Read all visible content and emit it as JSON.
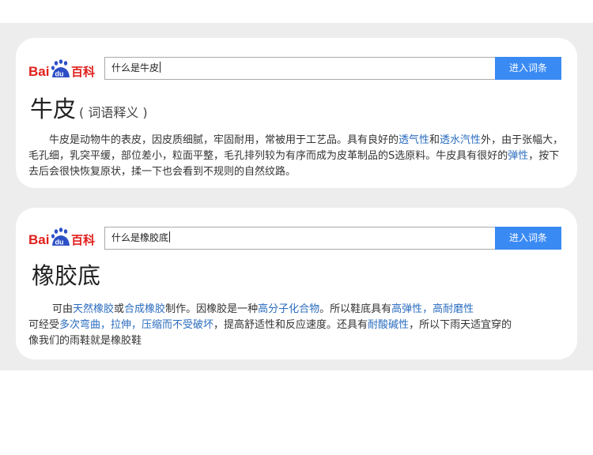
{
  "logo": {
    "text_bai": "Bai",
    "text_du": "du",
    "text_baike": "百科",
    "color_red": "#e0201c",
    "color_blue": "#2d4fc6"
  },
  "button_color": "#3a8af3",
  "card1": {
    "search_value": "什么是牛皮",
    "search_button": "进入词条",
    "title": "牛皮",
    "tag": "( 词语释义 )",
    "paragraph": [
      {
        "text": "牛皮是动物牛的表皮，因皮质细腻，牢固耐用，常被用于工艺品。具有良好的",
        "link": false
      },
      {
        "text": "透气性",
        "link": true
      },
      {
        "text": "和",
        "link": false
      },
      {
        "text": "透水汽性",
        "link": true
      },
      {
        "text": "外，由于张幅大，毛孔细，乳突平缓，部位差小，粒面平整，毛孔排列较为有序而成为皮革制品的S选原料。牛皮具有很好的",
        "link": false
      },
      {
        "text": "弹性",
        "link": true
      },
      {
        "text": "，按下去后会很快恢复原状，揉一下也会看到不规则的自然纹路。",
        "link": false
      }
    ]
  },
  "card2": {
    "search_value": "什么是橡胶底",
    "search_button": "进入词条",
    "title": "橡胶底",
    "paragraph": [
      {
        "text": "可由",
        "link": false
      },
      {
        "text": "天然橡胶",
        "link": true
      },
      {
        "text": "或",
        "link": false
      },
      {
        "text": "合成橡胶",
        "link": true
      },
      {
        "text": "制作。因橡胶是一种",
        "link": false
      },
      {
        "text": "高分子化合物",
        "link": true
      },
      {
        "text": "。所以鞋底具有",
        "link": false
      },
      {
        "text": "高弹性，高耐磨性",
        "link": true
      },
      {
        "text": "可经受",
        "link": false
      },
      {
        "text": "多次弯曲，拉伸，压缩而不受破坏",
        "link": true
      },
      {
        "text": "，提高舒适性和反应速度。还具有",
        "link": false
      },
      {
        "text": "耐酸碱性",
        "link": true
      },
      {
        "text": "，所以下雨天适宜穿的",
        "link": false
      },
      {
        "text": "像我们的雨鞋就是橡胶鞋",
        "link": false
      }
    ]
  }
}
